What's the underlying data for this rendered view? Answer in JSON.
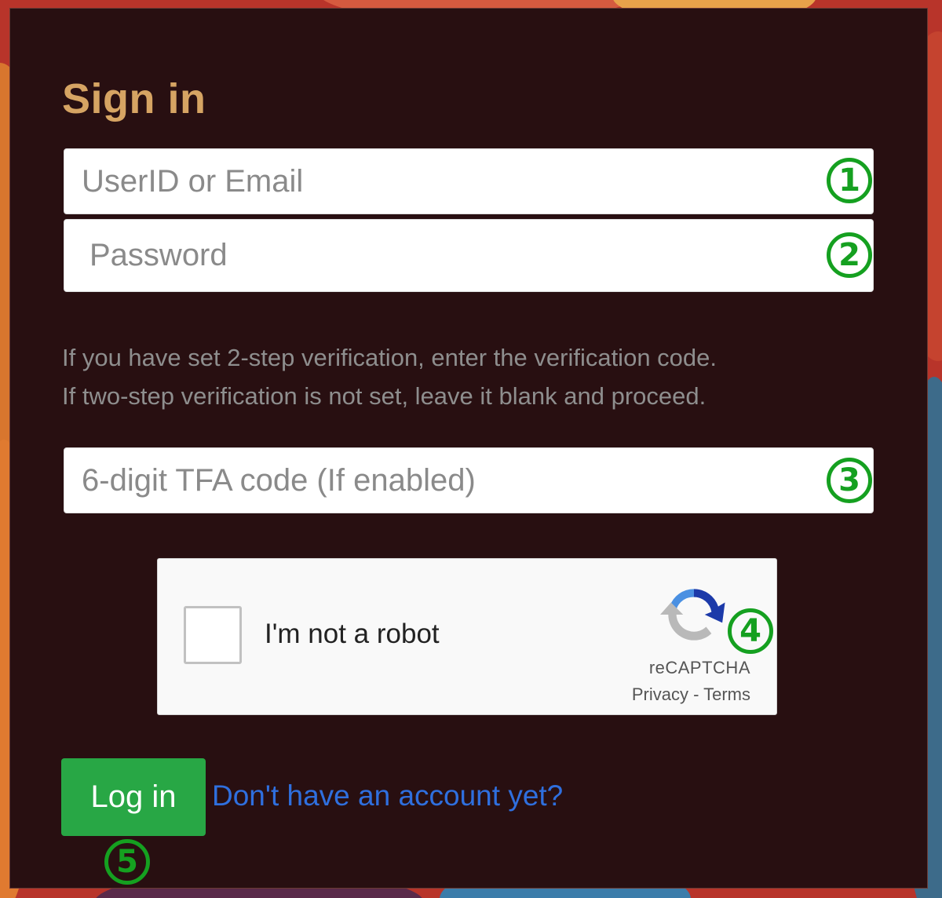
{
  "colors": {
    "panel_bg": "#280f11",
    "title": "#d6a463",
    "help_text": "#8e8e8e",
    "login_button": "#28a745",
    "link": "#2f6fde",
    "marker": "#15a020"
  },
  "form": {
    "title": "Sign in",
    "userid": {
      "placeholder": "UserID or Email",
      "value": ""
    },
    "password": {
      "placeholder": "Password",
      "value": ""
    },
    "help_line1": "If you have set 2-step verification, enter the verification code.",
    "help_line2": "If two-step verification is not set, leave it blank and proceed.",
    "tfa": {
      "placeholder": "6-digit TFA code (If enabled)",
      "value": ""
    },
    "login_label": "Log in",
    "signup_link": "Don't have an account yet?"
  },
  "captcha": {
    "label": "I'm not a robot",
    "brand": "reCAPTCHA",
    "privacy": "Privacy",
    "separator": " - ",
    "terms": "Terms",
    "logo_icon": "recaptcha-logo-icon"
  },
  "markers": [
    "1",
    "2",
    "3",
    "4",
    "5"
  ]
}
